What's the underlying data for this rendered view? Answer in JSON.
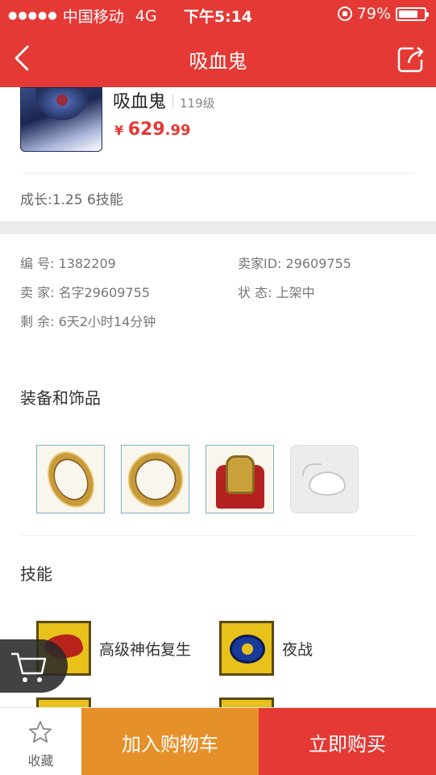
{
  "status_bar": {
    "carrier": "中国移动",
    "network": "4G",
    "time": "下午5:14",
    "battery_percent": "79%",
    "battery_level": 0.79
  },
  "nav": {
    "title": "吸血鬼",
    "back_icon": "chevron-left-icon",
    "share_icon": "share-icon"
  },
  "product": {
    "name": "吸血鬼",
    "level": "119级",
    "price_currency": "¥",
    "price_int": "629",
    "price_dec": ".99",
    "growth": "成长:1.25 6技能"
  },
  "info": {
    "id_label": "编  号: 1382209",
    "seller_id": "卖家ID: 29609755",
    "seller_label": "卖  家: 名字29609755",
    "status": "状  态: 上架中",
    "remaining": "剩  余: 6天2小时14分钟"
  },
  "equipment": {
    "title": "装备和饰品",
    "items": [
      "ring",
      "ring",
      "armor",
      "empty-pouch"
    ]
  },
  "skills": {
    "title": "技能",
    "items": [
      {
        "label": "高级神佑复生"
      },
      {
        "label": "夜战"
      }
    ]
  },
  "bottom_bar": {
    "favorite_label": "收藏",
    "add_to_cart": "加入购物车",
    "buy_now": "立即购买"
  },
  "colors": {
    "primary_red": "#e53935",
    "orange": "#e6902a"
  }
}
